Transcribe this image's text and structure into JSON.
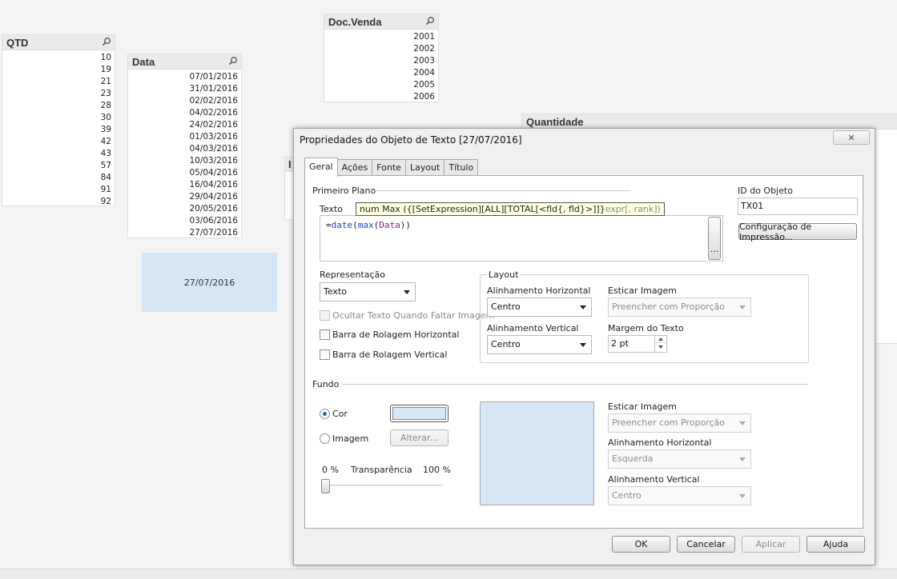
{
  "sheet": {
    "qtd": {
      "title": "QTD",
      "items": [
        "10",
        "19",
        "21",
        "23",
        "28",
        "30",
        "39",
        "42",
        "43",
        "57",
        "84",
        "91",
        "92"
      ]
    },
    "data": {
      "title": "Data",
      "items": [
        "07/01/2016",
        "31/01/2016",
        "02/02/2016",
        "04/02/2016",
        "24/02/2016",
        "01/03/2016",
        "04/03/2016",
        "10/03/2016",
        "05/04/2016",
        "16/04/2016",
        "29/04/2016",
        "20/05/2016",
        "03/06/2016",
        "27/07/2016"
      ]
    },
    "doc_venda": {
      "title": "Doc.Venda",
      "items": [
        "2001",
        "2002",
        "2003",
        "2004",
        "2005",
        "2006"
      ]
    },
    "quantidade": {
      "title": "Quantidade"
    },
    "text_object_value": "27/07/2016",
    "partial_label": "I"
  },
  "dialog": {
    "title": "Propriedades do Objeto de Texto [27/07/2016]",
    "close_glyph": "✕",
    "tabs": [
      "Geral",
      "Ações",
      "Fonte",
      "Layout",
      "Título"
    ],
    "primeiro_plano": "Primeiro Plano",
    "texto_label": "Texto",
    "expression": {
      "eq": "=",
      "fn1": "date",
      "p1": "(",
      "fn2": "max",
      "p2": "(",
      "field": "Data",
      "p3": "))"
    },
    "tooltip": {
      "main": "num Max ({[SetExpression][ALL][TOTAL[<fld{, fld}>]]}",
      "dim": "expr[, rank])"
    },
    "ellipsis": "...",
    "id_label": "ID do Objeto",
    "id_value": "TX01",
    "print_button": "Configuração de Impressão...",
    "representacao_label": "Representação",
    "representacao_value": "Texto",
    "hide_text_label": "Ocultar Texto Quando Faltar Imagem",
    "hscroll_label": "Barra de Rolagem Horizontal",
    "vscroll_label": "Barra de Rolagem Vertical",
    "layout": {
      "title": "Layout",
      "h_align_label": "Alinhamento Horizontal",
      "h_align_value": "Centro",
      "stretch_label": "Esticar Imagem",
      "stretch_value": "Preencher com Proporção",
      "v_align_label": "Alinhamento Vertical",
      "v_align_value": "Centro",
      "margin_label": "Margem do Texto",
      "margin_value": "2 pt"
    },
    "fundo": {
      "title": "Fundo",
      "cor_label": "Cor",
      "imagem_label": "Imagem",
      "alterar_button": "Alterar...",
      "transp_min": "0 %",
      "transp_label": "Transparência",
      "transp_max": "100 %",
      "transparency_value": 0,
      "stretch_label": "Esticar Imagem",
      "stretch_value": "Preencher com Proporção",
      "h_align_label": "Alinhamento Horizontal",
      "h_align_value": "Esquerda",
      "v_align_label": "Alinhamento Vertical",
      "v_align_value": "Centro",
      "color": "#d6e6f5"
    },
    "buttons": {
      "ok": "OK",
      "cancel": "Cancelar",
      "apply": "Aplicar",
      "help": "Ajuda"
    }
  }
}
